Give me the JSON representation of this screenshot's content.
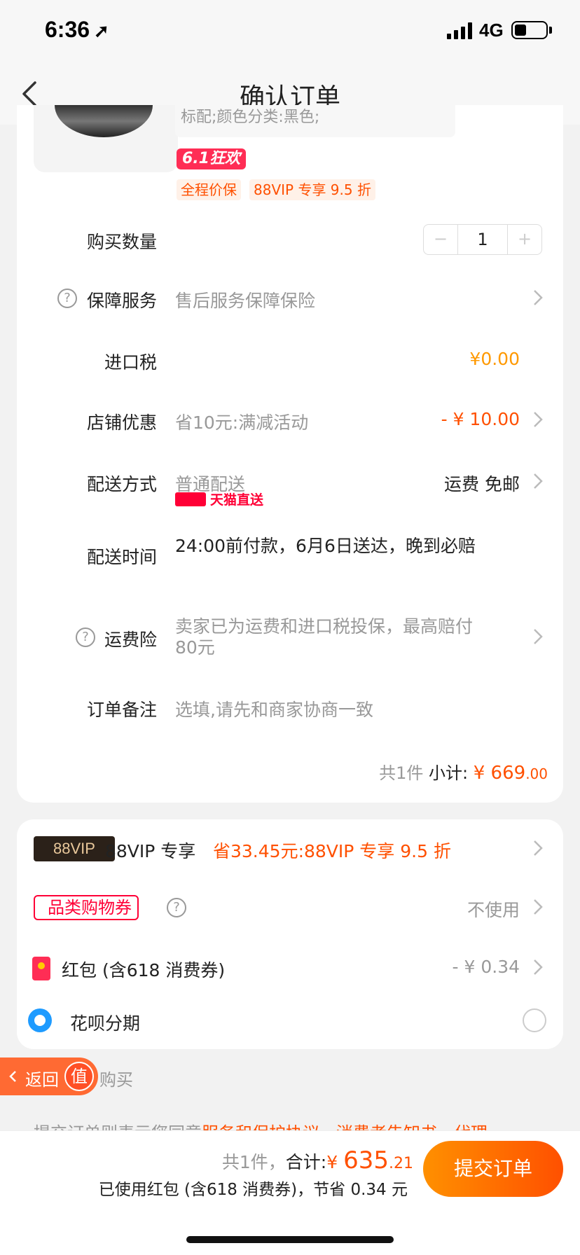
{
  "status": {
    "time": "6:36",
    "network": "4G"
  },
  "nav": {
    "title": "确认订单"
  },
  "product": {
    "spec": "标配;颜色分类:黑色;",
    "promo_logo": "6.1狂欢",
    "tags": [
      "全程价保",
      "88VIP 专享 9.5 折"
    ]
  },
  "order": {
    "quantity_label": "购买数量",
    "quantity": "1",
    "minus": "−",
    "plus": "+",
    "service_label": "保障服务",
    "service_value": "售后服务保障保险",
    "tax_label": "进口税",
    "tax_value": "¥0.00",
    "shop_discount_label": "店铺优惠",
    "shop_discount_desc": "省10元:满减活动",
    "shop_discount_value": "- ¥ 10.00",
    "delivery_label": "配送方式",
    "delivery_value": "普通配送",
    "delivery_fee": "运费 免邮",
    "delivery_time_label": "配送时间",
    "delivery_time_value": "24:00前付款，6月6日送达，晚到必赔",
    "tmall_direct": "天猫直送",
    "shipping_insurance_label": "运费险",
    "shipping_insurance_line1": "卖家已为运费和进口税投保，最高赔付",
    "shipping_insurance_line2": "80元",
    "note_label": "订单备注",
    "note_placeholder": "选填,请先和商家协商一致",
    "subtotal_count": "共1件",
    "subtotal_label": "小计:",
    "subtotal_currency": "¥",
    "subtotal_int": "669",
    "subtotal_dec": ".00"
  },
  "benefits": {
    "vip_badge": "88VIP",
    "vip_label": "88VIP 专享",
    "vip_desc": "省33.45元:88VIP 专享 9.5 折",
    "coupon_badge": "品类购物券",
    "coupon_value": "不使用",
    "redpacket_label": "红包 (含618 消费券)",
    "redpacket_value": "- ¥ 0.34",
    "huabei_label": "花呗分期"
  },
  "floating": {
    "return_label": "返回",
    "circle": "值",
    "buy": "购买"
  },
  "agreement": {
    "prefix": "提交订单则表示您同意",
    "link1": "服务和保护协议",
    "sep": "、",
    "link2": "消费者告知书",
    "link3": "代理"
  },
  "bottom": {
    "count": "共1件，",
    "total_label": "合计:",
    "currency": "¥ ",
    "total_int": "635",
    "total_dec": ".21",
    "savings": "已使用红包 (含618 消费券)，节省 0.34 元",
    "submit": "提交订单"
  },
  "colors": {
    "accent": "#ff5000",
    "tax": "#ff9900",
    "tmall": "#ff0036"
  }
}
